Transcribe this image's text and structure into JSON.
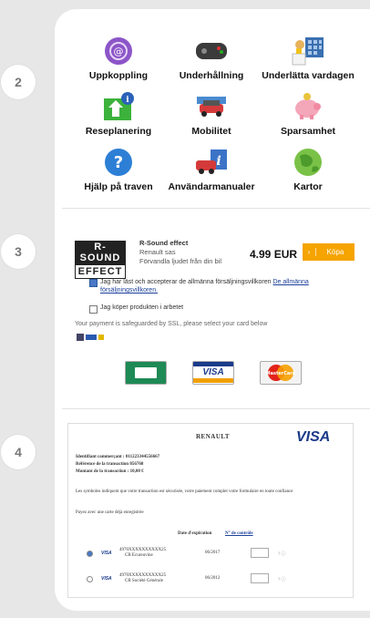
{
  "steps": [
    "2",
    "3",
    "4"
  ],
  "apps": [
    {
      "label": "Uppkoppling",
      "icon": "connection-icon"
    },
    {
      "label": "Underhållning",
      "icon": "gamepad-icon"
    },
    {
      "label": "Underlätta vardagen",
      "icon": "calendar-icon"
    },
    {
      "label": "Reseplanering",
      "icon": "route-icon"
    },
    {
      "label": "Mobilitet",
      "icon": "car-icon"
    },
    {
      "label": "Sparsamhet",
      "icon": "piggy-bank-icon"
    },
    {
      "label": "Hjälp på traven",
      "icon": "help-icon"
    },
    {
      "label": "Användarmanualer",
      "icon": "manual-icon"
    },
    {
      "label": "Kartor",
      "icon": "globe-icon"
    }
  ],
  "checkout": {
    "logo_top": "R-SOUND",
    "logo_bottom": "EFFECT",
    "product_title": "R-Sound effect",
    "product_vendor": "Renault sas",
    "product_desc": "Förvandla ljudet från din bil",
    "price": "4.99 EUR",
    "buy_label": "Köpa",
    "terms_text": "Jag har läst och accepterar de allmänna försäljningsvillkoren",
    "terms_link": "De allmänna försäljningsvillkoren.",
    "work_text": "Jag köper produkten i arbetet",
    "ssl_text": "Your payment is safeguarded by SSL, please select your card below",
    "cards": [
      "CB",
      "VISA",
      "MasterCard"
    ]
  },
  "payment": {
    "brand": "RENAULT",
    "card": "VISA",
    "merchant_id": "Identifiant commerçant : 011223344556667",
    "ref": "Référence de la transaction 856768",
    "amount": "Montant de la transaction : 10,00 €",
    "security": "Les symboles indiquent que votre transaction est sécurisée, votre paiement complet votre formulaire en toute confiance",
    "saved_cards": "Payez avec une carte déjà enregistrée",
    "expiry": "Date d'expiration",
    "cvv": "N° de contrôle",
    "rows": [
      {
        "number": "4970XXXXXXXXXX25",
        "name": "CB Ecureuvine",
        "date": "06/2017"
      },
      {
        "number": "4970XXXXXXXXXX25",
        "name": "CB Société Générale",
        "date": "06/2012"
      }
    ]
  }
}
